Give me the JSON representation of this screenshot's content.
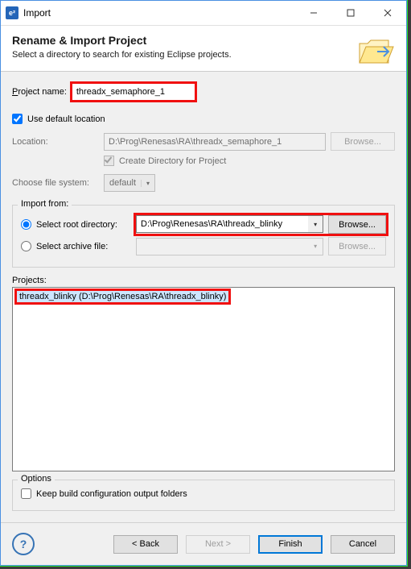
{
  "window": {
    "title": "Import",
    "app_icon_letter": "e²"
  },
  "header": {
    "title": "Rename & Import Project",
    "subtitle": "Select a directory to search for existing Eclipse projects."
  },
  "project_name": {
    "label": "Project name:",
    "value": "threadx_semaphore_1"
  },
  "use_default": {
    "label": "Use default location",
    "checked": true
  },
  "location": {
    "label": "Location:",
    "value": "D:\\Prog\\Renesas\\RA\\threadx_semaphore_1",
    "browse": "Browse..."
  },
  "create_dir": {
    "label": "Create Directory for Project"
  },
  "choose_fs": {
    "label": "Choose file system:",
    "value": "default"
  },
  "import_from": {
    "legend": "Import from:",
    "root_dir_label": "Select root directory:",
    "root_dir_value": "D:\\Prog\\Renesas\\RA\\threadx_blinky",
    "archive_label": "Select archive file:",
    "archive_value": "",
    "browse": "Browse..."
  },
  "projects": {
    "label": "Projects:",
    "items": [
      "threadx_blinky (D:\\Prog\\Renesas\\RA\\threadx_blinky)"
    ]
  },
  "options": {
    "legend": "Options",
    "keep_build_label": "Keep build configuration output folders",
    "keep_build_checked": false
  },
  "buttons": {
    "back": "< Back",
    "next": "Next >",
    "finish": "Finish",
    "cancel": "Cancel"
  }
}
